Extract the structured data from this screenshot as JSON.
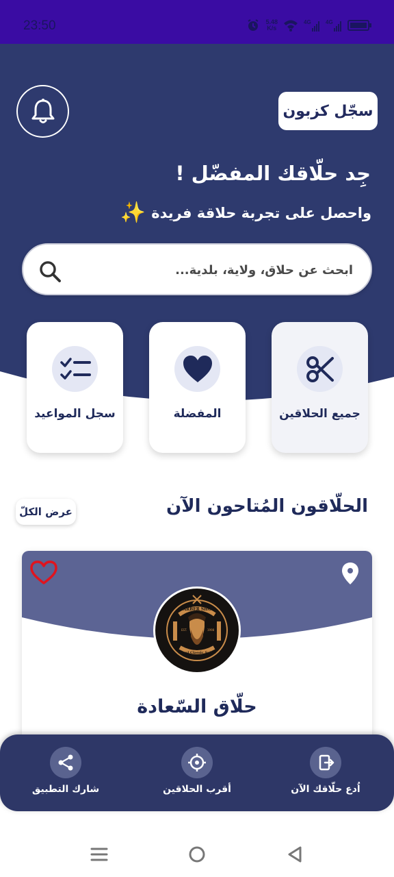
{
  "status_bar": {
    "time": "23:50",
    "net_speed_top": "5.48",
    "net_speed_bottom": "K/s",
    "signal_1": "4G",
    "signal_2": "4G"
  },
  "header": {
    "signup_label": "سجّل كزبون",
    "headline": "جِد حلّاقك المفضّل !",
    "subline": "واحصل على تجربة حلاقة فريدة",
    "sparkle": "✨"
  },
  "search": {
    "placeholder": "ابحث عن حلاق، ولاية، بلدية..."
  },
  "quick_actions": [
    {
      "label": "جميع الحلاقين",
      "icon": "scissors-icon"
    },
    {
      "label": "المفضلة",
      "icon": "heart-icon"
    },
    {
      "label": "سجل المواعيد",
      "icon": "checklist-icon"
    }
  ],
  "section": {
    "title": "الحلّاقون المُتاحون الآن",
    "view_all": "عرض الكلّ"
  },
  "barber_card": {
    "name": "حلّاق السّعادة",
    "logo_text_top": "BARBER SHOP",
    "logo_text_bottom": "Royal Classic Salon",
    "logo_est": "EST.",
    "logo_year": "1998"
  },
  "bottom_nav": [
    {
      "label": "اُدع حلّاقك الآن",
      "icon": "invite-icon"
    },
    {
      "label": "أقرب الحلاقين",
      "icon": "target-icon"
    },
    {
      "label": "شارك التطبيق",
      "icon": "share-icon"
    }
  ],
  "colors": {
    "navy": "#2e3a6e",
    "status_bar": "#3a0ca3",
    "card_wave": "#5c6494",
    "heart_red": "#e0141e",
    "sparkle": "#f6c21b"
  }
}
